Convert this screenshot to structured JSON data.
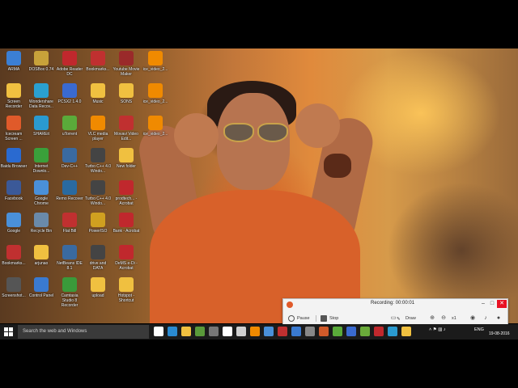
{
  "desktop": {
    "icons": [
      {
        "label": "ARMA",
        "color": "#3b7fd4"
      },
      {
        "label": "DOSBox 0.74",
        "color": "#c8a23a"
      },
      {
        "label": "Adobe Reader DC",
        "color": "#c0282d"
      },
      {
        "label": "Bookmarks...",
        "color": "#c03030"
      },
      {
        "label": "Youtube Movie Maker",
        "color": "#9a2a2a"
      },
      {
        "label": "ice_video_2...",
        "color": "#f08a00"
      },
      {
        "label": "Screen Recorder",
        "color": "#f0c040"
      },
      {
        "label": "Wondershare Data Recov...",
        "color": "#2aa0d0"
      },
      {
        "label": "PCSX2 1.4.0",
        "color": "#3a6ad0"
      },
      {
        "label": "Music",
        "color": "#f0c040"
      },
      {
        "label": "SONS",
        "color": "#f0c040"
      },
      {
        "label": "ice_video_2...",
        "color": "#f08a00"
      },
      {
        "label": "Icecream Screen ...",
        "color": "#e05a2a"
      },
      {
        "label": "SHAREit",
        "color": "#2a9ad0"
      },
      {
        "label": "uTorrent",
        "color": "#5aaa3a"
      },
      {
        "label": "VLC media player",
        "color": "#f08a00"
      },
      {
        "label": "Movavi Video Edit...",
        "color": "#c03030"
      },
      {
        "label": "ice_video_2...",
        "color": "#f08a00"
      },
      {
        "label": "Baidu Browser",
        "color": "#2a6ad0"
      },
      {
        "label": "Internet Downlo...",
        "color": "#3aa03a"
      },
      {
        "label": "Dev-C++",
        "color": "#3a6aa0"
      },
      {
        "label": "Turbo C++ 4.0 Windo...",
        "color": "#444444"
      },
      {
        "label": "New folder",
        "color": "#f0c040"
      },
      {
        "label": "Facebook",
        "color": "#3b5998"
      },
      {
        "label": "Google Chrome",
        "color": "#4a90d9"
      },
      {
        "label": "Remo Recover",
        "color": "#2a6aa0"
      },
      {
        "label": "Turbo C++ 4.0 Windo...",
        "color": "#444444"
      },
      {
        "label": "prodtech... - Acrobat",
        "color": "#c0282d"
      },
      {
        "label": "Google",
        "color": "#4a90d9"
      },
      {
        "label": "Recycle Bin",
        "color": "#6a8aaa"
      },
      {
        "label": "Flat Bill",
        "color": "#c03030"
      },
      {
        "label": "PowerISO",
        "color": "#d0a020"
      },
      {
        "label": "Bank - Acrobat",
        "color": "#c0282d"
      },
      {
        "label": "Bookmarks...",
        "color": "#c03030"
      },
      {
        "label": "arjunao",
        "color": "#f0c040"
      },
      {
        "label": "NetBeans IDE 8.1",
        "color": "#3a6aa0"
      },
      {
        "label": "drive and DATA",
        "color": "#444444"
      },
      {
        "label": "DeMS e-Di - Acrobat",
        "color": "#c0282d"
      },
      {
        "label": "Screenshot...",
        "color": "#555555"
      },
      {
        "label": "Control Panel",
        "color": "#3a7ad0"
      },
      {
        "label": "Camtasia Studio 8 Recorder",
        "color": "#3a9a3a"
      },
      {
        "label": "upload",
        "color": "#f0c040"
      },
      {
        "label": "Hotspot - Shortcut",
        "color": "#f0c040"
      }
    ]
  },
  "recorder": {
    "status": "Recording:  00:00:01",
    "pause_label": "Pause",
    "stop_label": "Stop",
    "draw_label": "Draw",
    "zoom_label": "x1",
    "minimize": "–",
    "maximize": "□",
    "close": "✕"
  },
  "taskbar": {
    "search_placeholder": "Search the web and Windows",
    "language": "ENG",
    "time": "",
    "date": "19-08-2016",
    "apps": [
      {
        "name": "task-view",
        "color": "#ffffff"
      },
      {
        "name": "edge",
        "color": "#2a8ad0"
      },
      {
        "name": "file-explorer",
        "color": "#f0c040"
      },
      {
        "name": "photos",
        "color": "#5a9a3a"
      },
      {
        "name": "settings",
        "color": "#777777"
      },
      {
        "name": "store",
        "color": "#ffffff"
      },
      {
        "name": "hp",
        "color": "#d0d0d0"
      },
      {
        "name": "vlc",
        "color": "#f08a00"
      },
      {
        "name": "chrome",
        "color": "#4a90d9"
      },
      {
        "name": "app-1",
        "color": "#c03030"
      },
      {
        "name": "app-2",
        "color": "#3a7ad0"
      },
      {
        "name": "app-3",
        "color": "#888888"
      },
      {
        "name": "app-4",
        "color": "#d05a2a"
      },
      {
        "name": "app-5",
        "color": "#5aaa3a"
      },
      {
        "name": "app-6",
        "color": "#3a6ad0"
      },
      {
        "name": "app-7",
        "color": "#6aaa3a"
      },
      {
        "name": "app-8",
        "color": "#c0282d"
      },
      {
        "name": "app-9",
        "color": "#2a9ad0"
      },
      {
        "name": "icecream",
        "color": "#f0c040"
      }
    ]
  }
}
